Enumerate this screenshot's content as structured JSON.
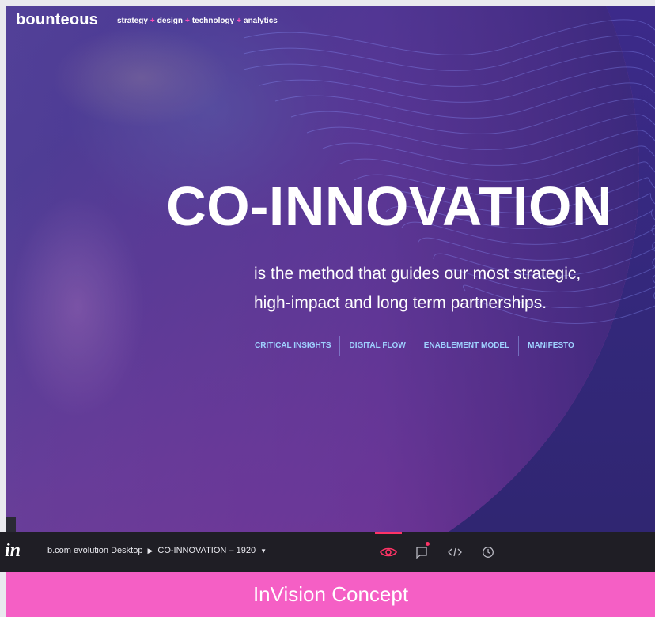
{
  "site": {
    "logo": "bounteous",
    "tagline": {
      "parts": [
        "strategy",
        "design",
        "technology",
        "analytics"
      ],
      "separator": "+"
    }
  },
  "hero": {
    "title": "CO-INNOVATION",
    "subtitle_line1": "is the method that guides our most strategic,",
    "subtitle_line2": "high-impact and long term partnerships."
  },
  "nav_links": [
    "CRITICAL INSIGHTS",
    "DIGITAL FLOW",
    "ENABLEMENT MODEL",
    "MANIFESTO"
  ],
  "invision_bar": {
    "logo": "in",
    "project": "b.com evolution Desktop",
    "separator_icon": "chevron-right-icon",
    "screen": "CO-INNOVATION – 1920",
    "dropdown_icon": "caret-down-icon",
    "tools": [
      {
        "name": "preview-mode",
        "icon": "eye-icon",
        "active": true
      },
      {
        "name": "comment-mode",
        "icon": "comment-icon",
        "active": false,
        "has_notification": true
      },
      {
        "name": "inspect-mode",
        "icon": "code-icon",
        "active": false
      },
      {
        "name": "history-mode",
        "icon": "clock-icon",
        "active": false
      }
    ]
  },
  "footer": {
    "label": "InVision Concept"
  },
  "colors": {
    "hero_bg": "#33287a",
    "accent_pink": "#ff4fb8",
    "link_blue": "#9fd1ff",
    "toolbar_bg": "#1f1e25",
    "active_red": "#ff3366",
    "footer_pink": "#f55fc5"
  }
}
